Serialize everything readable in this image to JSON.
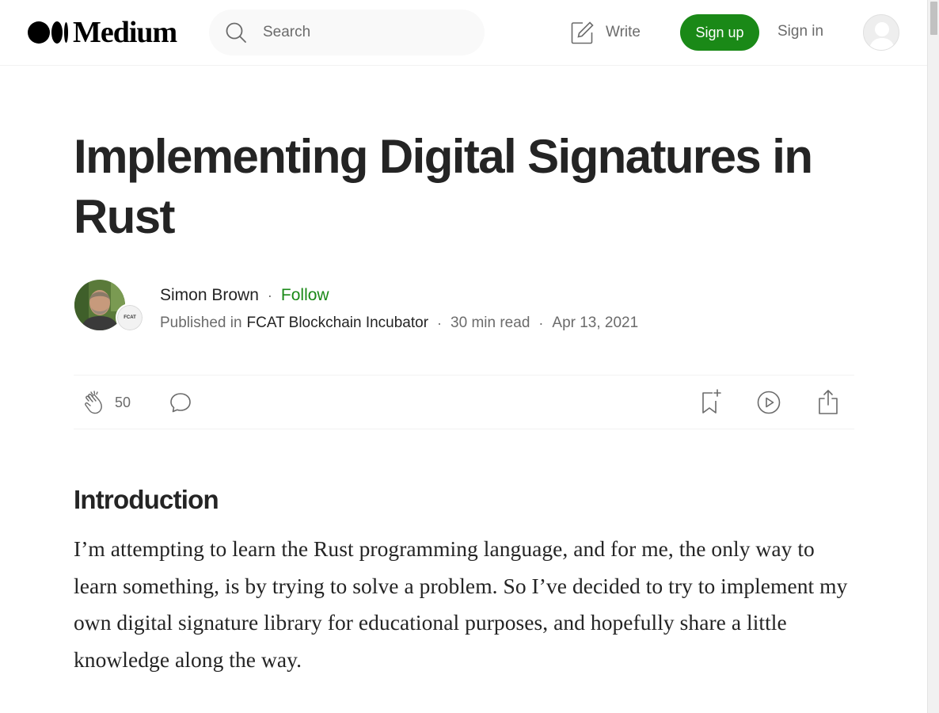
{
  "header": {
    "logo_text": "Medium",
    "search_placeholder": "Search",
    "write_label": "Write",
    "signup_label": "Sign up",
    "signin_label": "Sign in"
  },
  "article": {
    "title": "Implementing Digital Signatures in Rust",
    "author": "Simon Brown",
    "separator": "·",
    "follow_label": "Follow",
    "published_in_label": "Published in",
    "publication": "FCAT Blockchain Incubator",
    "publication_avatar_text": "FCAT",
    "read_time": "30 min read",
    "date": "Apr 13, 2021",
    "clap_count": "50",
    "section_heading": "Introduction",
    "intro_paragraph": "I’m attempting to learn the Rust programming language, and for me, the only way to learn something, is by trying to solve a problem. So I’ve decided to try to implement my own digital signature library for educational purposes, and hopefully share a little knowledge along the way."
  },
  "colors": {
    "accent_green": "#1a8917",
    "text": "#242424",
    "muted": "#6b6b6b"
  },
  "icons": [
    "medium-logo-icon",
    "search-icon",
    "write-icon",
    "user-avatar-icon",
    "clap-icon",
    "comment-icon",
    "bookmark-icon",
    "listen-icon",
    "share-icon"
  ]
}
